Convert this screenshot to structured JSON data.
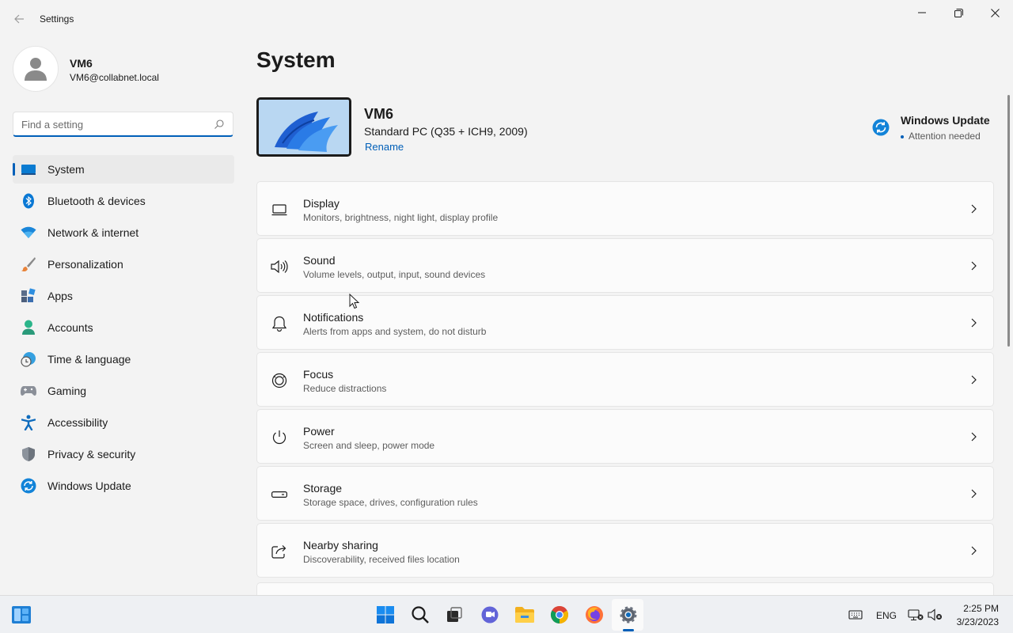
{
  "window": {
    "title": "Settings",
    "back_icon": "back-arrow-icon",
    "controls": [
      "minimize-icon",
      "maximize-icon",
      "close-icon"
    ]
  },
  "profile": {
    "name": "VM6",
    "email": "VM6@collabnet.local"
  },
  "search": {
    "placeholder": "Find a setting",
    "value": ""
  },
  "sidebar": {
    "items": [
      {
        "label": "System",
        "icon": "system-icon",
        "active": true
      },
      {
        "label": "Bluetooth & devices",
        "icon": "bluetooth-icon"
      },
      {
        "label": "Network & internet",
        "icon": "wifi-icon"
      },
      {
        "label": "Personalization",
        "icon": "brush-icon"
      },
      {
        "label": "Apps",
        "icon": "apps-icon"
      },
      {
        "label": "Accounts",
        "icon": "accounts-icon"
      },
      {
        "label": "Time & language",
        "icon": "time-language-icon"
      },
      {
        "label": "Gaming",
        "icon": "gamepad-icon"
      },
      {
        "label": "Accessibility",
        "icon": "accessibility-icon"
      },
      {
        "label": "Privacy & security",
        "icon": "shield-icon"
      },
      {
        "label": "Windows Update",
        "icon": "windows-update-icon"
      }
    ]
  },
  "main": {
    "title": "System",
    "device": {
      "name": "VM6",
      "model": "Standard PC (Q35 + ICH9, 2009)",
      "rename_label": "Rename"
    },
    "windows_update": {
      "title": "Windows Update",
      "status": "Attention needed"
    },
    "cards": [
      {
        "title": "Display",
        "subtitle": "Monitors, brightness, night light, display profile",
        "icon": "display-icon"
      },
      {
        "title": "Sound",
        "subtitle": "Volume levels, output, input, sound devices",
        "icon": "speaker-icon"
      },
      {
        "title": "Notifications",
        "subtitle": "Alerts from apps and system, do not disturb",
        "icon": "bell-icon"
      },
      {
        "title": "Focus",
        "subtitle": "Reduce distractions",
        "icon": "focus-icon"
      },
      {
        "title": "Power",
        "subtitle": "Screen and sleep, power mode",
        "icon": "power-icon"
      },
      {
        "title": "Storage",
        "subtitle": "Storage space, drives, configuration rules",
        "icon": "storage-icon"
      },
      {
        "title": "Nearby sharing",
        "subtitle": "Discoverability, received files location",
        "icon": "share-icon"
      }
    ]
  },
  "taskbar": {
    "apps": [
      "start-icon",
      "search-icon",
      "task-view-icon",
      "teams-chat-icon",
      "file-explorer-icon",
      "chrome-icon",
      "firefox-icon",
      "settings-icon"
    ],
    "active_app": "settings-icon",
    "language": "ENG",
    "time": "2:25 PM",
    "date": "3/23/2023"
  },
  "colors": {
    "accent": "#005fb8",
    "background": "#f3f3f3",
    "card": "#fbfbfb"
  }
}
